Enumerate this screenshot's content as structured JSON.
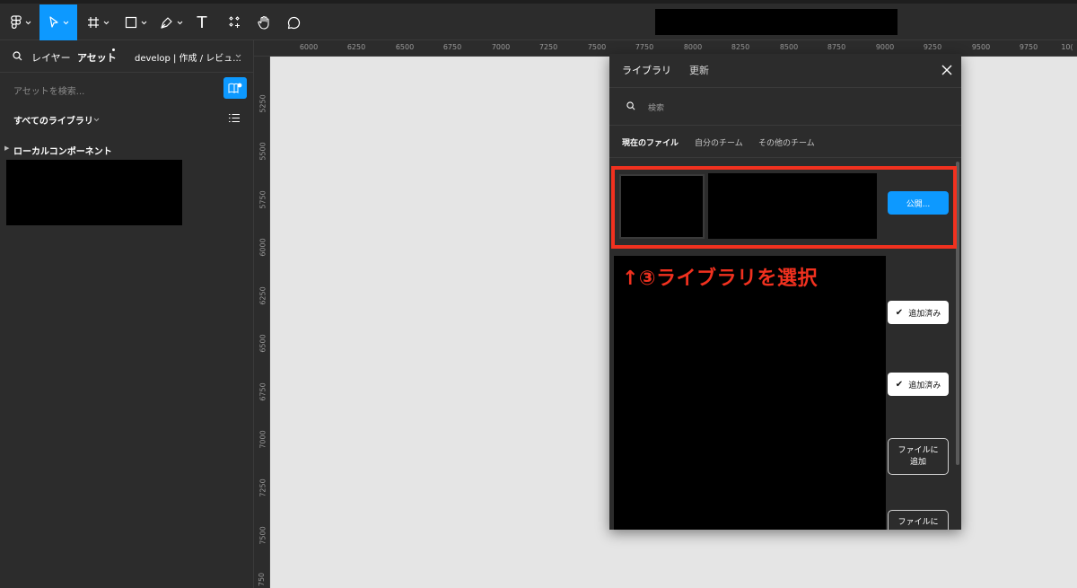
{
  "toolbar": {
    "tools": [
      {
        "name": "main-menu",
        "icon": "figma-logo-icon"
      },
      {
        "name": "move-tool",
        "icon": "cursor-icon"
      },
      {
        "name": "frame-tool",
        "icon": "hash-icon"
      },
      {
        "name": "shape-tool",
        "icon": "rectangle-icon"
      },
      {
        "name": "pen-tool",
        "icon": "pen-icon"
      },
      {
        "name": "text-tool",
        "icon": "text-icon",
        "glyph": "T"
      },
      {
        "name": "resources-tool",
        "icon": "components-icon"
      },
      {
        "name": "hand-tool",
        "icon": "hand-icon"
      },
      {
        "name": "comment-tool",
        "icon": "comment-icon"
      }
    ],
    "active_color": "#0d99ff"
  },
  "left_panel": {
    "tab_layers": "レイヤー",
    "tab_assets": "アセット",
    "page_selector": "develop | 作成 / レビュ...",
    "search_placeholder": "アセットを検索...",
    "library_filter": "すべてのライブラリ",
    "local_components": "ローカルコンポーネント"
  },
  "ruler": {
    "top_ticks": [
      "6000",
      "6250",
      "6500",
      "6750",
      "7000",
      "7250",
      "7500",
      "7750",
      "8000",
      "8250",
      "8500",
      "8750",
      "9000",
      "9250",
      "9500",
      "9750",
      "10("
    ],
    "left_ticks": [
      "5250",
      "5500",
      "5750",
      "6000",
      "6250",
      "6500",
      "6750",
      "7000",
      "7250",
      "7500",
      "750"
    ]
  },
  "modal": {
    "tab_library": "ライブラリ",
    "tab_updates": "更新",
    "search_placeholder": "検索",
    "filters": [
      "現在のファイル",
      "自分のチーム",
      "その他のチーム"
    ],
    "publish_label": "公開...",
    "added_label": "追加済み",
    "add_to_file_line1": "ファイルに",
    "add_to_file_line2": "追加",
    "annotation": "↑③ライブラリを選択"
  },
  "colors": {
    "accent": "#0d99ff",
    "annotation_red": "#f1311f",
    "panel_bg": "#2c2c2c",
    "canvas_bg": "#e5e5e5"
  }
}
